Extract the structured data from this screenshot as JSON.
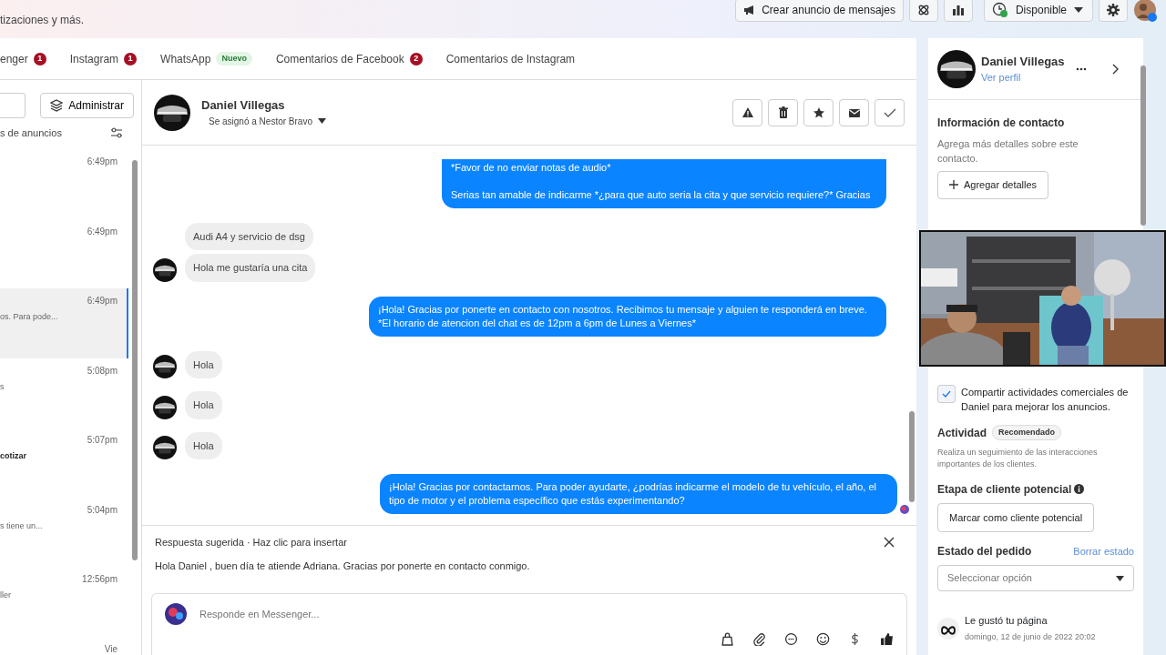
{
  "header": {
    "subtitle": "tizaciones y más.",
    "create_ad": "Crear anuncio de mensajes",
    "status": "Disponible"
  },
  "tabs": [
    {
      "label": "enger",
      "count": "1",
      "selected": false
    },
    {
      "label": "Instagram",
      "count": "1",
      "selected": false
    },
    {
      "label": "WhatsApp",
      "tag": "Nuevo",
      "selected": false
    },
    {
      "label": "Comentarios de Facebook",
      "count": "2",
      "selected": false
    },
    {
      "label": "Comentarios de Instagram",
      "selected": false
    }
  ],
  "inbox": {
    "manage": "Administrar",
    "filter": "s de anuncios",
    "items": [
      {
        "time": "6:49pm",
        "selected": false
      },
      {
        "time": "6:49pm",
        "selected": false
      },
      {
        "time": "6:49pm",
        "snippet": "os. Para pode...",
        "selected": true,
        "unread": false
      },
      {
        "time": "5:08pm",
        "snippet": "s",
        "selected": false,
        "unread": false
      },
      {
        "time": "5:07pm",
        "snippet": "cotizar",
        "selected": false,
        "unread": true
      },
      {
        "time": "5:04pm",
        "snippet": "s tiene un...",
        "selected": false,
        "unread": false
      },
      {
        "time": "12:56pm",
        "snippet": "ller",
        "selected": false,
        "unread": false
      },
      {
        "time": "Vie",
        "selected": false
      }
    ]
  },
  "conversation": {
    "name": "Daniel Villegas",
    "assigned": "Se asignó a Nestor Bravo",
    "messages": [
      {
        "kind": "out",
        "lines": [
          "*Favor de no enviar notas de audio*"
        ],
        "lines_after_break": [
          "Serias tan amable de indicarme *¿para que auto seria la cita y que servicio requiere?* Gracias"
        ]
      },
      {
        "kind": "in",
        "lines": [
          "Audi A4 y servicio de dsg"
        ],
        "avatar": false
      },
      {
        "kind": "in",
        "lines": [
          "Hola me gustaría una cita"
        ],
        "avatar": true
      },
      {
        "kind": "out",
        "lines": [
          "¡Hola! Gracias por ponerte en contacto con nosotros. Recibimos tu mensaje y alguien te responderá en breve.",
          "*El horario de atencion del chat es de 12pm a 6pm de Lunes a Viernes*"
        ]
      },
      {
        "kind": "in",
        "lines": [
          "Hola"
        ],
        "avatar": true
      },
      {
        "kind": "in",
        "lines": [
          "Hola"
        ],
        "avatar": true
      },
      {
        "kind": "in",
        "lines": [
          "Hola"
        ],
        "avatar": true
      },
      {
        "kind": "out",
        "lines": [
          "¡Hola! Gracias por contactarnos. Para poder ayudarte, ¿podrías indicarme el modelo de tu vehículo, el año, el tipo de motor y el problema específico que estás experimentando?"
        ],
        "seen": true
      }
    ],
    "suggestion_label": "Respuesta sugerida · Haz clic para insertar",
    "suggestion": "Hola Daniel , buen día te atiende Adriana. Gracias por ponerte en contacto conmigo.",
    "reply_placeholder": "Responde en Messenger..."
  },
  "contact": {
    "name": "Daniel Villegas",
    "profile_link": "Ver perfil",
    "info_title": "Información de contacto",
    "info_text": "Agrega más detalles sobre este contacto.",
    "add_details": "Agregar detalles",
    "share": {
      "label": "Compartir actividades comerciales de Daniel para mejorar los anuncios.",
      "checked": true
    },
    "activity_title": "Actividad",
    "activity_badge": "Recomendado",
    "activity_text": "Realiza un seguimiento de las interacciones importantes de los clientes.",
    "lead_title": "Etapa de cliente potencial",
    "lead_button": "Marcar como cliente potencial",
    "order_title": "Estado del pedido",
    "order_clear": "Borrar estado",
    "order_placeholder": "Seleccionar opción",
    "event_title": "Le gustó tu página",
    "event_date": "domingo, 12 de junio de 2022 20:02"
  }
}
